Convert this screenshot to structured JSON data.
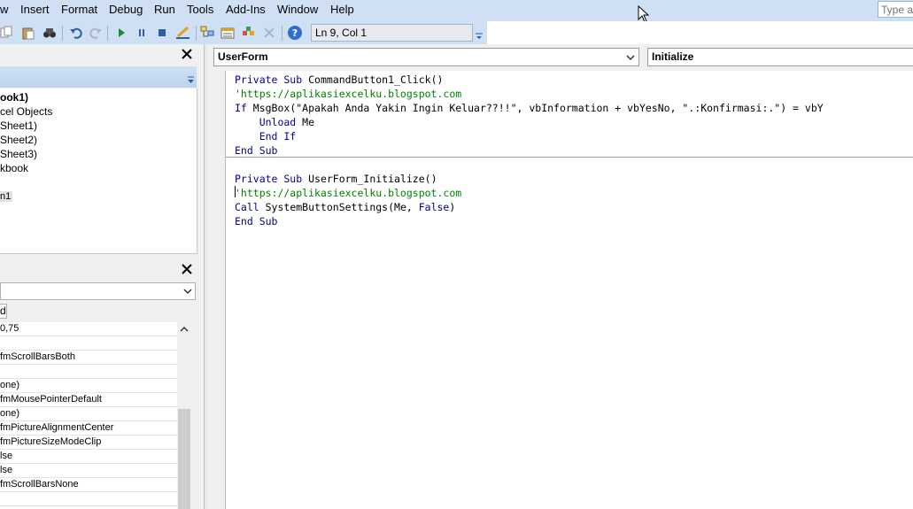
{
  "menu": {
    "items": [
      "w",
      "Insert",
      "Format",
      "Debug",
      "Run",
      "Tools",
      "Add-Ins",
      "Window",
      "Help"
    ],
    "help_placeholder": "Type a"
  },
  "toolbar": {
    "status": "Ln 9, Col 1"
  },
  "project_explorer": {
    "items": [
      "ook1)",
      "cel Objects",
      "Sheet1)",
      "Sheet2)",
      "Sheet3)",
      "kbook",
      "n1"
    ]
  },
  "properties": {
    "tab": "d",
    "rows": [
      "0,75",
      "",
      " fmScrollBarsBoth",
      "",
      "one)",
      " fmMousePointerDefault",
      "one)",
      " fmPictureAlignmentCenter",
      " fmPictureSizeModeClip",
      "lse",
      "lse",
      " fmScrollBarsNone"
    ]
  },
  "code": {
    "object": "UserForm",
    "procedure": "Initialize",
    "lines": [
      [
        {
          "t": "Private Sub ",
          "c": "kw"
        },
        {
          "t": "CommandButton1_Click()",
          "c": ""
        }
      ],
      [
        {
          "t": "'https://aplikasiexcelku.blogspot.com",
          "c": "cm"
        }
      ],
      [
        {
          "t": "If ",
          "c": "kw"
        },
        {
          "t": "MsgBox(\"Apakah Anda Yakin Ingin Keluar??!!\", vbInformation + vbYesNo, \".:Konfirmasi:.\") = vbY",
          "c": ""
        }
      ],
      [
        {
          "t": "    Unload ",
          "c": "kw"
        },
        {
          "t": "Me",
          "c": ""
        }
      ],
      [
        {
          "t": "    End If",
          "c": "kw"
        }
      ],
      [
        {
          "t": "End Sub",
          "c": "kw"
        }
      ],
      [],
      [
        {
          "t": "Private Sub ",
          "c": "kw"
        },
        {
          "t": "UserForm_Initialize()",
          "c": ""
        }
      ],
      [
        {
          "t": "'https://aplikasiexcelku.blogspot.com",
          "c": "cm"
        }
      ],
      [
        {
          "t": "Call ",
          "c": "kw"
        },
        {
          "t": "SystemButtonSettings(Me, ",
          "c": ""
        },
        {
          "t": "False",
          "c": "kw"
        },
        {
          "t": ")",
          "c": ""
        }
      ],
      [
        {
          "t": "End Sub",
          "c": "kw"
        }
      ]
    ]
  },
  "colors": {
    "menu_bg": "#cfe0f5",
    "keyword": "#00008b",
    "comment": "#008000"
  },
  "icons": [
    "cut-icon",
    "copy-icon",
    "paste-icon",
    "find-icon",
    "undo-icon",
    "redo-icon",
    "run-icon",
    "break-icon",
    "reset-icon",
    "design-mode-icon",
    "project-explorer-icon",
    "properties-icon",
    "object-browser-icon",
    "toolbox-icon",
    "help-icon"
  ]
}
